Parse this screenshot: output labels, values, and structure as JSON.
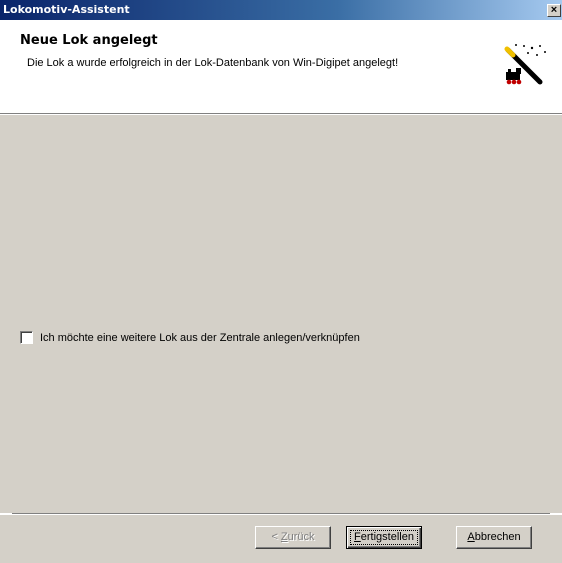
{
  "window": {
    "title": "Lokomotiv-Assistent",
    "close_symbol": "×"
  },
  "header": {
    "title": "Neue Lok angelegt",
    "subtitle": "Die Lok a wurde erfolgreich in der Lok-Datenbank von Win-Digipet angelegt!",
    "icon": "magic-wand-locomotive-icon"
  },
  "content": {
    "checkbox_label": "Ich möchte eine weitere Lok aus der Zentrale anlegen/verknüpfen",
    "checkbox_checked": false
  },
  "footer": {
    "back_prefix": "< ",
    "back_access": "Z",
    "back_rest": "urück",
    "finish_access": "F",
    "finish_rest": "ertigstellen",
    "cancel_access": "A",
    "cancel_rest": "bbrechen"
  },
  "colors": {
    "titlebar_start": "#0a246a",
    "titlebar_end": "#a6caf0",
    "face": "#d4d0c8"
  }
}
